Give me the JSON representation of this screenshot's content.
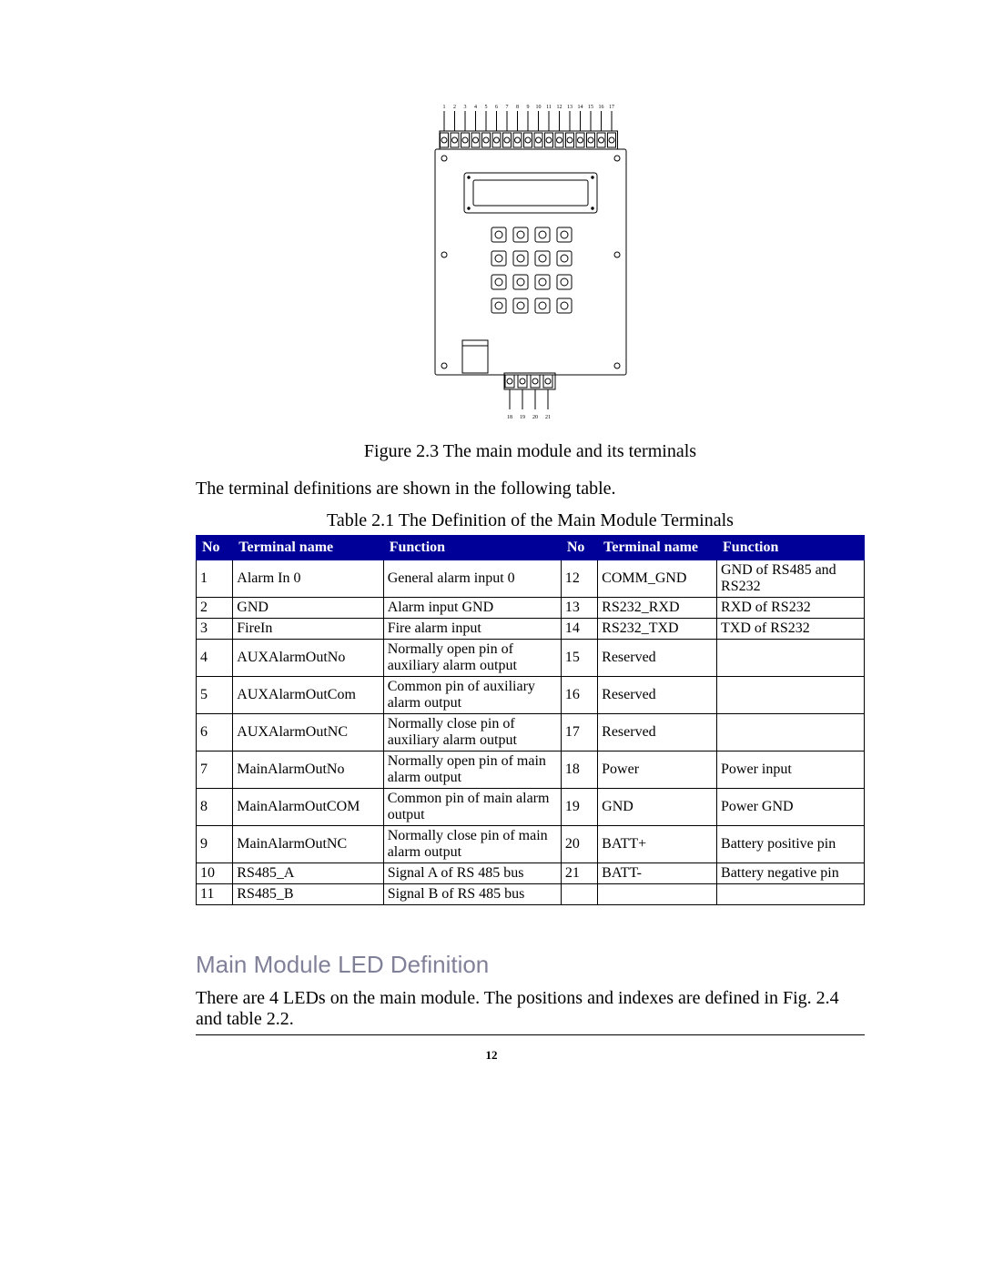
{
  "figure": {
    "caption": "Figure 2.3 The main module and its terminals",
    "top_terminal_labels": [
      "1",
      "2",
      "3",
      "4",
      "5",
      "6",
      "7",
      "8",
      "9",
      "10",
      "11",
      "12",
      "13",
      "14",
      "15",
      "16",
      "17"
    ],
    "bottom_terminal_labels": [
      "18",
      "19",
      "20",
      "21"
    ]
  },
  "intro_text": "The terminal definitions are shown in the following table.",
  "table": {
    "caption": "Table 2.1 The Definition of the Main Module Terminals",
    "headers": {
      "no": "No",
      "terminal_name": "Terminal name",
      "function": "Function",
      "no2": "No",
      "terminal_name2": "Terminal name",
      "function2": "Function"
    },
    "rows": [
      {
        "no": "1",
        "name": "Alarm In 0",
        "func": "General alarm input 0",
        "no2": "12",
        "name2": "COMM_GND",
        "func2": "GND of RS485 and RS232"
      },
      {
        "no": "2",
        "name": "GND",
        "func": "Alarm input GND",
        "no2": "13",
        "name2": "RS232_RXD",
        "func2": "RXD of RS232"
      },
      {
        "no": "3",
        "name": "FireIn",
        "func": "Fire alarm input",
        "no2": "14",
        "name2": "RS232_TXD",
        "func2": "TXD of RS232"
      },
      {
        "no": "4",
        "name": "AUXAlarmOutNo",
        "func": "Normally open pin of auxiliary alarm output",
        "no2": "15",
        "name2": "Reserved",
        "func2": ""
      },
      {
        "no": "5",
        "name": "AUXAlarmOutCom",
        "func": "Common pin of auxiliary alarm output",
        "no2": "16",
        "name2": "Reserved",
        "func2": ""
      },
      {
        "no": "6",
        "name": "AUXAlarmOutNC",
        "func": "Normally close pin of auxiliary alarm output",
        "no2": "17",
        "name2": "Reserved",
        "func2": ""
      },
      {
        "no": "7",
        "name": "MainAlarmOutNo",
        "func": "Normally open pin of main alarm output",
        "no2": "18",
        "name2": "Power",
        "func2": "Power input"
      },
      {
        "no": "8",
        "name": "MainAlarmOutCOM",
        "func": "Common pin of main alarm output",
        "no2": "19",
        "name2": "GND",
        "func2": "Power GND"
      },
      {
        "no": "9",
        "name": "MainAlarmOutNC",
        "func": "Normally close pin of main alarm output",
        "no2": "20",
        "name2": "BATT+",
        "func2": "Battery positive pin"
      },
      {
        "no": "10",
        "name": "RS485_A",
        "func": "Signal A of RS 485 bus",
        "no2": "21",
        "name2": "BATT-",
        "func2": "Battery negative pin"
      },
      {
        "no": "11",
        "name": "RS485_B",
        "func": "Signal B of RS 485 bus",
        "no2": "",
        "name2": "",
        "func2": ""
      }
    ]
  },
  "section": {
    "heading": "Main Module LED Definition",
    "body": "There are 4 LEDs on the main module.  The positions and indexes are defined in Fig. 2.4 and table 2.2."
  },
  "page_number": "12"
}
